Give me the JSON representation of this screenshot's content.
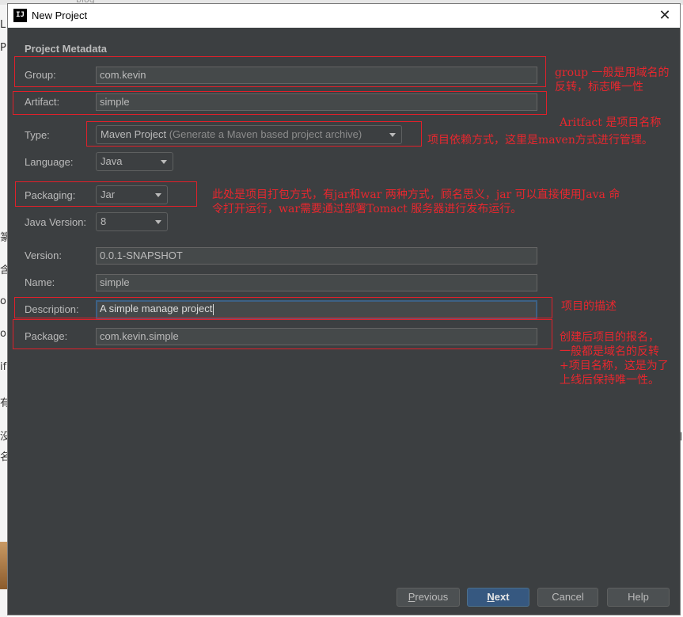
{
  "window": {
    "title": "New Project",
    "app_icon": "IJ"
  },
  "background": {
    "top_text": "blog",
    "side_chars": [
      "L",
      "P",
      "篆",
      "含",
      "ou",
      "ou",
      "if",
      "有",
      "没",
      "名"
    ],
    "right_char": "自"
  },
  "section_title": "Project Metadata",
  "form": {
    "group": {
      "label": "Group:",
      "value": "com.kevin"
    },
    "artifact": {
      "label": "Artifact:",
      "value": "simple"
    },
    "type": {
      "label": "Type:",
      "value": "Maven Project",
      "hint": "(Generate a Maven based project archive)"
    },
    "language": {
      "label": "Language:",
      "value": "Java"
    },
    "packaging": {
      "label": "Packaging:",
      "value": "Jar"
    },
    "java_version": {
      "label": "Java Version:",
      "value": "8"
    },
    "version": {
      "label": "Version:",
      "value": "0.0.1-SNAPSHOT"
    },
    "name": {
      "label": "Name:",
      "value": "simple"
    },
    "description": {
      "label": "Description:",
      "value": "A simple manage project"
    },
    "package": {
      "label": "Package:",
      "value": "com.kevin.simple"
    }
  },
  "annotations": {
    "group_note": [
      "group 一般是用域名的",
      "反转，标志唯一性"
    ],
    "artifact_note": "Aritfact 是项目名称",
    "type_note": "项目依赖方式，这里是maven方式进行管理。",
    "packaging_note": [
      "此处是项目打包方式，有jar和war 两种方式，顾名思义，jar 可以直接使用Java 命",
      "令打开运行，war需要通过部署Tomact 服务器进行发布运行。"
    ],
    "description_note": "项目的描述",
    "package_note": [
      "创建后项目的报名，",
      "一般都是域名的反转",
      "+项目名称，这是为了",
      "上线后保持唯一性。"
    ]
  },
  "buttons": {
    "previous": {
      "mnemonic": "P",
      "rest": "revious"
    },
    "next": {
      "mnemonic": "N",
      "rest": "ext"
    },
    "cancel": "Cancel",
    "help": "Help"
  },
  "colors": {
    "dialog_bg": "#3c3f41",
    "field_bg": "#45494a",
    "annotation": "#e8272e",
    "primary_button": "#365880"
  }
}
